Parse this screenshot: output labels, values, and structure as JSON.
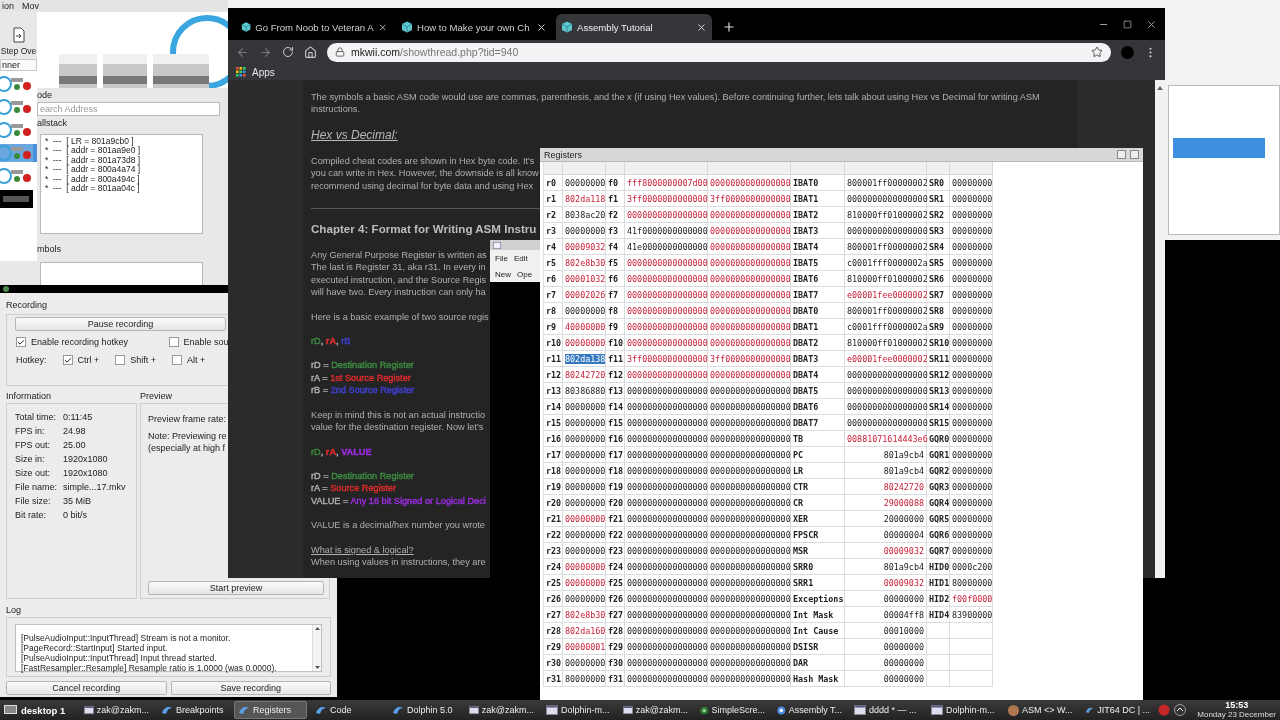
{
  "debugger": {
    "menu": [
      "ion",
      "Mov"
    ],
    "step_button": "Step Ove",
    "list_header": "nner",
    "code_label": "ode",
    "search": {
      "placeholder": "earch Address"
    },
    "callstack_label": "allstack",
    "callstack": [
      "*  ---  [ LR = 801a9cb0 ]",
      "*  ---  [ addr = 801aa9e0 ]",
      "*  ---  [ addr = 801a73d8 ]",
      "*  ---  [ addr = 800a4a74 ]",
      "*  ---  [ addr = 800a494c ]",
      "*  ---  [ addr = 801aa04c ]"
    ],
    "symbols_label": "mbols"
  },
  "browser": {
    "tabs": [
      {
        "title": "Go From Noob to Veteran A",
        "selected": false
      },
      {
        "title": "How to Make your own Ch",
        "selected": false
      },
      {
        "title": "Assembly Tutorial",
        "selected": true
      }
    ],
    "url_host": "mkwii.com",
    "url_path": "/showthread.php?tid=940",
    "bookmarks": [
      "Apps"
    ],
    "article": [
      {
        "kind": "paragraph",
        "text": "The symbols a basic ASM code would use are commas, parenthesis, and the x (if using Hex values). Before continuing further, lets talk about using Hex vs Decimal for writing ASM instructions."
      },
      {
        "kind": "subheading",
        "text": "Hex vs Decimal:"
      },
      {
        "kind": "lines",
        "lines": [
          "Compiled cheat codes are shown in Hex byte code. It's",
          "you can write in Hex. However, the downside is all know",
          "recommend using decimal for byte data and using Hex"
        ]
      },
      {
        "kind": "rule"
      },
      {
        "kind": "chapter",
        "text": "Chapter 4: Format for Writing ASM Instru"
      },
      {
        "kind": "lines",
        "lines": [
          "Any General Purpose Register is written as",
          "The last is Register 31, aka r31. In every in",
          "executed instruction, and the Source Regis",
          "will have two. Every instruction can only ha"
        ]
      },
      {
        "kind": "lines",
        "lines": [
          "Here is a basic example of two source regis"
        ]
      },
      {
        "kind": "tokens",
        "tokens": [
          {
            "text": "rD",
            "color": "#3d8b40",
            "bold": false
          },
          {
            "text": ", ",
            "bold": false
          },
          {
            "text": "rA",
            "color": "#e02b2b",
            "bold": true
          },
          {
            "text": ", ",
            "bold": false
          },
          {
            "text": "rB",
            "color": "#4040d8",
            "bold": false
          }
        ]
      },
      {
        "kind": "definitions",
        "items": [
          {
            "label": "rD = ",
            "text": "Destination Register",
            "color": "#3d8b40"
          },
          {
            "label": "rA = ",
            "text": "1st Source Register",
            "color": "#e02b2b"
          },
          {
            "label": "rB = ",
            "text": "2nd Source Register",
            "color": "#4040d8"
          }
        ]
      },
      {
        "kind": "lines",
        "lines": [
          "Keep in mind this is not an actual instructio",
          "value for the destination register. Now let's"
        ]
      },
      {
        "kind": "tokens",
        "tokens": [
          {
            "text": "rD",
            "color": "#3d8b40",
            "bold": false
          },
          {
            "text": ", ",
            "bold": false
          },
          {
            "text": "rA",
            "color": "#e02b2b",
            "bold": true
          },
          {
            "text": ", ",
            "bold": false
          },
          {
            "text": "VALUE",
            "color": "#9a2de0",
            "bold": true
          }
        ]
      },
      {
        "kind": "definitions",
        "items": [
          {
            "label": "rD = ",
            "text": "Destination Register",
            "color": "#3d8b40"
          },
          {
            "label": "rA = ",
            "text": "Source Register",
            "color": "#e02b2b"
          },
          {
            "label": "VALUE = ",
            "text": "Any 16 bit Signed or Logical Deci",
            "color": "#9a2de0"
          }
        ]
      },
      {
        "kind": "lines",
        "lines": [
          "VALUE is a decimal/hex number you wrote"
        ]
      },
      {
        "kind": "question",
        "text": "What is signed & logical?",
        "lines": [
          "When using values in instructions, they are"
        ]
      }
    ]
  },
  "editor": {
    "menu": [
      "File",
      "Edit"
    ],
    "toolbar": [
      "New",
      "Ope"
    ]
  },
  "registers": {
    "title": "Registers",
    "rows": [
      {
        "name": "r0",
        "value": "00000000",
        "changed": false,
        "selected": false,
        "fname": "f0",
        "ps0": "fff8000000007d00",
        "ps0_changed": true,
        "ps1": "0000000000000000",
        "ps1_changed": true,
        "special": "IBAT0",
        "special_value": "800001ff00000002",
        "special_changed": false,
        "sr": "SR0",
        "sr_value": "00000000",
        "sr_changed": false
      },
      {
        "name": "r1",
        "value": "802da118",
        "changed": true,
        "selected": false,
        "fname": "f1",
        "ps0": "3ff0000000000000",
        "ps0_changed": true,
        "ps1": "3ff0000000000000",
        "ps1_changed": true,
        "special": "IBAT1",
        "special_value": "0000000000000000",
        "special_changed": false,
        "sr": "SR1",
        "sr_value": "00000000",
        "sr_changed": false
      },
      {
        "name": "r2",
        "value": "8038ac20",
        "changed": false,
        "selected": false,
        "fname": "f2",
        "ps0": "0000000000000000",
        "ps0_changed": true,
        "ps1": "0000000000000000",
        "ps1_changed": true,
        "special": "IBAT2",
        "special_value": "810000ff01000002",
        "special_changed": false,
        "sr": "SR2",
        "sr_value": "00000000",
        "sr_changed": false
      },
      {
        "name": "r3",
        "value": "00000000",
        "changed": false,
        "selected": false,
        "fname": "f3",
        "ps0": "41f0000000000000",
        "ps0_changed": false,
        "ps1": "0000000000000000",
        "ps1_changed": true,
        "special": "IBAT3",
        "special_value": "0000000000000000",
        "special_changed": false,
        "sr": "SR3",
        "sr_value": "00000000",
        "sr_changed": false
      },
      {
        "name": "r4",
        "value": "00009032",
        "changed": true,
        "selected": false,
        "fname": "f4",
        "ps0": "41e0000000000000",
        "ps0_changed": false,
        "ps1": "0000000000000000",
        "ps1_changed": true,
        "special": "IBAT4",
        "special_value": "800001ff00000002",
        "special_changed": false,
        "sr": "SR4",
        "sr_value": "00000000",
        "sr_changed": false
      },
      {
        "name": "r5",
        "value": "802e8b30",
        "changed": true,
        "selected": false,
        "fname": "f5",
        "ps0": "0000000000000000",
        "ps0_changed": true,
        "ps1": "0000000000000000",
        "ps1_changed": true,
        "special": "IBAT5",
        "special_value": "c0001fff0000002a",
        "special_changed": false,
        "sr": "SR5",
        "sr_value": "00000000",
        "sr_changed": false
      },
      {
        "name": "r6",
        "value": "00001032",
        "changed": true,
        "selected": false,
        "fname": "f6",
        "ps0": "0000000000000000",
        "ps0_changed": true,
        "ps1": "0000000000000000",
        "ps1_changed": true,
        "special": "IBAT6",
        "special_value": "810000ff01000002",
        "special_changed": false,
        "sr": "SR6",
        "sr_value": "00000000",
        "sr_changed": false
      },
      {
        "name": "r7",
        "value": "00002026",
        "changed": true,
        "selected": false,
        "fname": "f7",
        "ps0": "0000000000000000",
        "ps0_changed": true,
        "ps1": "0000000000000000",
        "ps1_changed": true,
        "special": "IBAT7",
        "special_value": "e00001fee0000002",
        "special_changed": true,
        "sr": "SR7",
        "sr_value": "00000000",
        "sr_changed": false
      },
      {
        "name": "r8",
        "value": "00000000",
        "changed": false,
        "selected": false,
        "fname": "f8",
        "ps0": "0000000000000000",
        "ps0_changed": true,
        "ps1": "0000000000000000",
        "ps1_changed": true,
        "special": "DBAT0",
        "special_value": "800001ff00000002",
        "special_changed": false,
        "sr": "SR8",
        "sr_value": "00000000",
        "sr_changed": false
      },
      {
        "name": "r9",
        "value": "40000000",
        "changed": true,
        "selected": false,
        "fname": "f9",
        "ps0": "0000000000000000",
        "ps0_changed": true,
        "ps1": "0000000000000000",
        "ps1_changed": true,
        "special": "DBAT1",
        "special_value": "c0001fff0000002a",
        "special_changed": false,
        "sr": "SR9",
        "sr_value": "00000000",
        "sr_changed": false
      },
      {
        "name": "r10",
        "value": "00000000",
        "changed": true,
        "selected": false,
        "fname": "f10",
        "ps0": "0000000000000000",
        "ps0_changed": true,
        "ps1": "0000000000000000",
        "ps1_changed": true,
        "special": "DBAT2",
        "special_value": "810000ff01000002",
        "special_changed": false,
        "sr": "SR10",
        "sr_value": "00000000",
        "sr_changed": false
      },
      {
        "name": "r11",
        "value": "802da138",
        "changed": false,
        "selected": true,
        "fname": "f11",
        "ps0": "3ff0000000000000",
        "ps0_changed": true,
        "ps1": "3ff0000000000000",
        "ps1_changed": true,
        "special": "DBAT3",
        "special_value": "e00001fee0000002",
        "special_changed": true,
        "sr": "SR11",
        "sr_value": "00000000",
        "sr_changed": false
      },
      {
        "name": "r12",
        "value": "80242720",
        "changed": true,
        "selected": false,
        "fname": "f12",
        "ps0": "0000000000000000",
        "ps0_changed": true,
        "ps1": "0000000000000000",
        "ps1_changed": true,
        "special": "DBAT4",
        "special_value": "0000000000000000",
        "special_changed": false,
        "sr": "SR12",
        "sr_value": "00000000",
        "sr_changed": false
      },
      {
        "name": "r13",
        "value": "80386880",
        "changed": false,
        "selected": false,
        "fname": "f13",
        "ps0": "0000000000000000",
        "ps0_changed": false,
        "ps1": "0000000000000000",
        "ps1_changed": false,
        "special": "DBAT5",
        "special_value": "0000000000000000",
        "special_changed": false,
        "sr": "SR13",
        "sr_value": "00000000",
        "sr_changed": false
      },
      {
        "name": "r14",
        "value": "00000000",
        "changed": false,
        "selected": false,
        "fname": "f14",
        "ps0": "0000000000000000",
        "ps0_changed": false,
        "ps1": "0000000000000000",
        "ps1_changed": false,
        "special": "DBAT6",
        "special_value": "0000000000000000",
        "special_changed": false,
        "sr": "SR14",
        "sr_value": "00000000",
        "sr_changed": false
      },
      {
        "name": "r15",
        "value": "00000000",
        "changed": false,
        "selected": false,
        "fname": "f15",
        "ps0": "0000000000000000",
        "ps0_changed": false,
        "ps1": "0000000000000000",
        "ps1_changed": false,
        "special": "DBAT7",
        "special_value": "0000000000000000",
        "special_changed": false,
        "sr": "SR15",
        "sr_value": "00000000",
        "sr_changed": false
      },
      {
        "name": "r16",
        "value": "00000000",
        "changed": false,
        "selected": false,
        "fname": "f16",
        "ps0": "0000000000000000",
        "ps0_changed": false,
        "ps1": "0000000000000000",
        "ps1_changed": false,
        "special": "TB",
        "special_value": "00881071614443e6",
        "special_changed": true,
        "sr": "GQR0",
        "sr_value": "00000000",
        "sr_changed": false
      },
      {
        "name": "r17",
        "value": "00000000",
        "changed": false,
        "selected": false,
        "fname": "f17",
        "ps0": "0000000000000000",
        "ps0_changed": false,
        "ps1": "0000000000000000",
        "ps1_changed": false,
        "special": "PC",
        "special_value": "801a9cb4",
        "special_changed": false,
        "sr": "GQR1",
        "sr_value": "00000000",
        "sr_changed": false
      },
      {
        "name": "r18",
        "value": "00000000",
        "changed": false,
        "selected": false,
        "fname": "f18",
        "ps0": "0000000000000000",
        "ps0_changed": false,
        "ps1": "0000000000000000",
        "ps1_changed": false,
        "special": "LR",
        "special_value": "801a9cb4",
        "special_changed": false,
        "sr": "GQR2",
        "sr_value": "00000000",
        "sr_changed": false
      },
      {
        "name": "r19",
        "value": "00000000",
        "changed": false,
        "selected": false,
        "fname": "f19",
        "ps0": "0000000000000000",
        "ps0_changed": false,
        "ps1": "0000000000000000",
        "ps1_changed": false,
        "special": "CTR",
        "special_value": "80242720",
        "special_changed": true,
        "sr": "GQR3",
        "sr_value": "00000000",
        "sr_changed": false
      },
      {
        "name": "r20",
        "value": "00000000",
        "changed": false,
        "selected": false,
        "fname": "f20",
        "ps0": "0000000000000000",
        "ps0_changed": false,
        "ps1": "0000000000000000",
        "ps1_changed": false,
        "special": "CR",
        "special_value": "29000088",
        "special_changed": true,
        "sr": "GQR4",
        "sr_value": "00000000",
        "sr_changed": false
      },
      {
        "name": "r21",
        "value": "00000000",
        "changed": true,
        "selected": false,
        "fname": "f21",
        "ps0": "0000000000000000",
        "ps0_changed": false,
        "ps1": "0000000000000000",
        "ps1_changed": false,
        "special": "XER",
        "special_value": "20000000",
        "special_changed": false,
        "sr": "GQR5",
        "sr_value": "00000000",
        "sr_changed": false
      },
      {
        "name": "r22",
        "value": "00000000",
        "changed": false,
        "selected": false,
        "fname": "f22",
        "ps0": "0000000000000000",
        "ps0_changed": false,
        "ps1": "0000000000000000",
        "ps1_changed": false,
        "special": "FPSCR",
        "special_value": "00000004",
        "special_changed": false,
        "sr": "GQR6",
        "sr_value": "00000000",
        "sr_changed": false
      },
      {
        "name": "r23",
        "value": "00000000",
        "changed": false,
        "selected": false,
        "fname": "f23",
        "ps0": "0000000000000000",
        "ps0_changed": false,
        "ps1": "0000000000000000",
        "ps1_changed": false,
        "special": "MSR",
        "special_value": "00009032",
        "special_changed": true,
        "sr": "GQR7",
        "sr_value": "00000000",
        "sr_changed": false
      },
      {
        "name": "r24",
        "value": "00000000",
        "changed": true,
        "selected": false,
        "fname": "f24",
        "ps0": "0000000000000000",
        "ps0_changed": false,
        "ps1": "0000000000000000",
        "ps1_changed": false,
        "special": "SRR0",
        "special_value": "801a9cb4",
        "special_changed": false,
        "sr": "HID0",
        "sr_value": "0000c200",
        "sr_changed": false
      },
      {
        "name": "r25",
        "value": "00000000",
        "changed": true,
        "selected": false,
        "fname": "f25",
        "ps0": "0000000000000000",
        "ps0_changed": false,
        "ps1": "0000000000000000",
        "ps1_changed": false,
        "special": "SRR1",
        "special_value": "00009032",
        "special_changed": true,
        "sr": "HID1",
        "sr_value": "80000000",
        "sr_changed": false
      },
      {
        "name": "r26",
        "value": "00000000",
        "changed": false,
        "selected": false,
        "fname": "f26",
        "ps0": "0000000000000000",
        "ps0_changed": false,
        "ps1": "0000000000000000",
        "ps1_changed": false,
        "special": "Exceptions",
        "special_value": "00000000",
        "special_changed": false,
        "sr": "HID2",
        "sr_value": "f00f0000",
        "sr_changed": true
      },
      {
        "name": "r27",
        "value": "802e8b30",
        "changed": true,
        "selected": false,
        "fname": "f27",
        "ps0": "0000000000000000",
        "ps0_changed": false,
        "ps1": "0000000000000000",
        "ps1_changed": false,
        "special": "Int Mask",
        "special_value": "00004ff8",
        "special_changed": false,
        "sr": "HID4",
        "sr_value": "83900000",
        "sr_changed": false
      },
      {
        "name": "r28",
        "value": "802da160",
        "changed": true,
        "selected": false,
        "fname": "f28",
        "ps0": "0000000000000000",
        "ps0_changed": false,
        "ps1": "0000000000000000",
        "ps1_changed": false,
        "special": "Int Cause",
        "special_value": "00010000",
        "special_changed": false
      },
      {
        "name": "r29",
        "value": "00000001",
        "changed": true,
        "selected": false,
        "fname": "f29",
        "ps0": "0000000000000000",
        "ps0_changed": false,
        "ps1": "0000000000000000",
        "ps1_changed": false,
        "special": "DSISR",
        "special_value": "00000000",
        "special_changed": false
      },
      {
        "name": "r30",
        "value": "00000000",
        "changed": false,
        "selected": false,
        "fname": "f30",
        "ps0": "0000000000000000",
        "ps0_changed": false,
        "ps1": "0000000000000000",
        "ps1_changed": false,
        "special": "DAR",
        "special_value": "00000000",
        "special_changed": false
      },
      {
        "name": "r31",
        "value": "80000000",
        "changed": false,
        "selected": false,
        "fname": "f31",
        "ps0": "0000000000000000",
        "ps0_changed": false,
        "ps1": "0000000000000000",
        "ps1_changed": false,
        "special": "Hash Mask",
        "special_value": "00000000",
        "special_changed": false
      }
    ]
  },
  "recorder": {
    "section": "Recording",
    "pause_button": "Pause recording",
    "options": [
      {
        "label": "Enable recording hotkey",
        "checked": true
      },
      {
        "label": "Enable sou",
        "checked": false
      }
    ],
    "hotkey_label": "Hotkey:",
    "modifiers": [
      {
        "label": "Ctrl +",
        "checked": true
      },
      {
        "label": "Shift +",
        "checked": false
      },
      {
        "label": "Alt +",
        "checked": false
      }
    ],
    "information_title": "Information",
    "info": [
      {
        "label": "Total time:",
        "value": "0:11:45"
      },
      {
        "label": "FPS in:",
        "value": "24.98"
      },
      {
        "label": "FPS out:",
        "value": "25.00"
      },
      {
        "label": "Size in:",
        "value": "1920x1080"
      },
      {
        "label": "Size out:",
        "value": "1920x1080"
      },
      {
        "label": "File name:",
        "value": "simple...17.mkv"
      },
      {
        "label": "File size:",
        "value": "35 MiB"
      },
      {
        "label": "Bit rate:",
        "value": "0 bit/s"
      }
    ],
    "preview_title": "Preview",
    "preview_lines": [
      "Preview frame rate:",
      "Note: Previewing re",
      "(especially at high f"
    ],
    "start_preview": "Start preview",
    "log_title": "Log",
    "log": [
      "[PulseAudioInput::InputThread] Stream is not a monitor.",
      "[PageRecord::StartInput] Started input.",
      "[PulseAudioInput::InputThread] Input thread started.",
      "[FastResampler::Resample] Resample ratio is 1.0000 (was 0.0000)."
    ],
    "buttons": [
      "Cancel recording",
      "Save recording"
    ]
  },
  "taskbar": {
    "desktop": "desktop 1",
    "tasks": [
      {
        "label": "zak@zakm...",
        "kind": "window",
        "selected": false
      },
      {
        "label": "Breakpoints",
        "kind": "swoosh",
        "selected": false
      },
      {
        "label": "Registers",
        "kind": "swoosh",
        "selected": true
      },
      {
        "label": "Code",
        "kind": "swoosh",
        "selected": false
      },
      {
        "label": "Dolphin 5.0",
        "kind": "swoosh",
        "selected": false
      },
      {
        "label": "zak@zakm...",
        "kind": "window",
        "selected": false
      },
      {
        "label": "Dolphin-m...",
        "kind": "window",
        "selected": false
      },
      {
        "label": "zak@zakm...",
        "kind": "window",
        "selected": false
      },
      {
        "label": "SimpleScre...",
        "kind": "disc",
        "selected": false
      },
      {
        "label": "Assembly T...",
        "kind": "circle",
        "selected": false
      },
      {
        "label": "dddd * — ...",
        "kind": "window",
        "selected": false
      },
      {
        "label": "Dolphin-m...",
        "kind": "window",
        "selected": false
      },
      {
        "label": "ASM <> W...",
        "kind": "avatar",
        "selected": false
      },
      {
        "label": "JIT64 DC | ...",
        "kind": "swoosh",
        "selected": false
      }
    ],
    "clock": {
      "time": "15:53",
      "date": "Monday 23 December"
    }
  }
}
